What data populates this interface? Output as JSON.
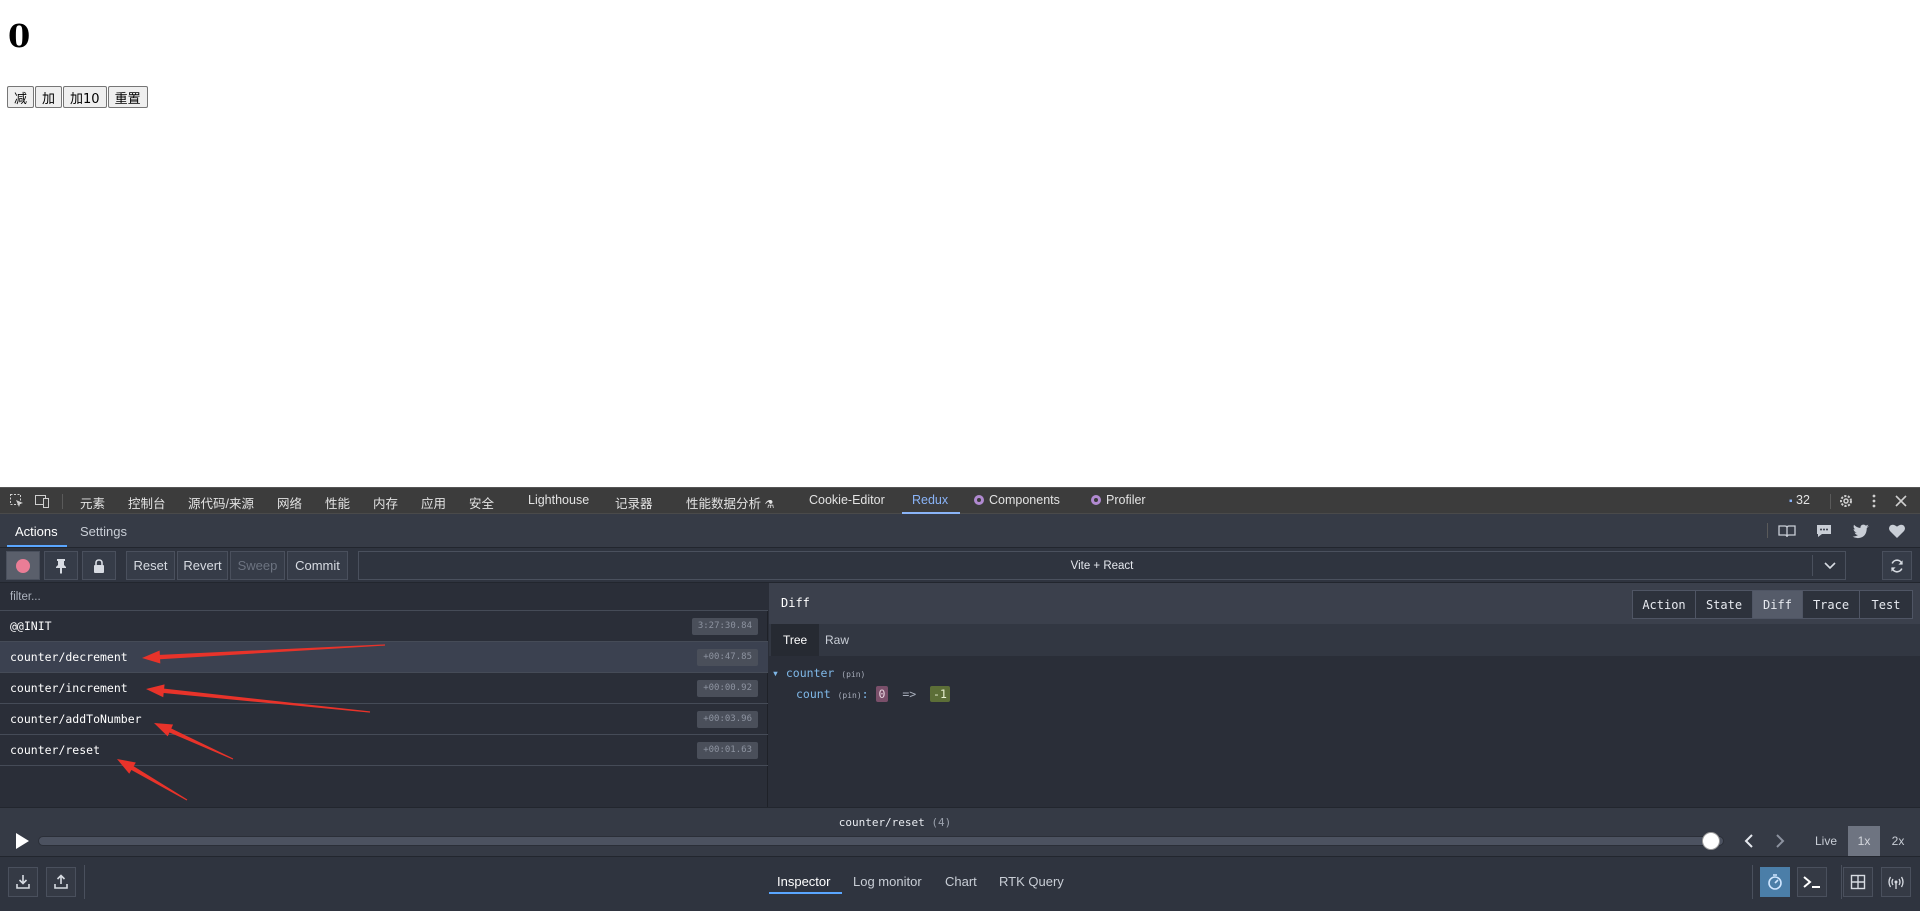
{
  "page": {
    "counter_value": "0",
    "buttons": [
      "减",
      "加",
      "加10",
      "重置"
    ]
  },
  "devtools": {
    "tabs": [
      "元素",
      "控制台",
      "源代码/来源",
      "网络",
      "性能",
      "内存",
      "应用",
      "安全",
      "Lighthouse",
      "记录器",
      "性能数据分析",
      "Cookie-Editor",
      "Redux",
      "Components",
      "Profiler"
    ],
    "active_tab": "Redux",
    "issues_count": "32"
  },
  "redux": {
    "top_tabs": [
      "Actions",
      "Settings"
    ],
    "toolbar": {
      "reset": "Reset",
      "revert": "Revert",
      "sweep": "Sweep",
      "commit": "Commit"
    },
    "instance": "Vite + React",
    "filter_placeholder": "filter...",
    "actions": [
      {
        "name": "@@INIT",
        "time": "3:27:30.84"
      },
      {
        "name": "counter/decrement",
        "time": "+00:47.85"
      },
      {
        "name": "counter/increment",
        "time": "+00:00.92"
      },
      {
        "name": "counter/addToNumber",
        "time": "+00:03.96"
      },
      {
        "name": "counter/reset",
        "time": "+00:01.63"
      }
    ],
    "panel_title": "Diff",
    "panel_tabs": [
      "Action",
      "State",
      "Diff",
      "Trace",
      "Test"
    ],
    "active_panel_tab": "Diff",
    "view_tabs": [
      "Tree",
      "Raw"
    ],
    "diff": {
      "root_key": "counter",
      "pin": "(pin)",
      "child_key": "count",
      "child_pin": "(pin)",
      "colon": ":",
      "old_value": "0",
      "arrow": "=>",
      "new_value": "-1"
    },
    "slider": {
      "label": "counter/reset",
      "count": "(4)",
      "value_fraction": 1.0
    },
    "speed": {
      "live": "Live",
      "one": "1x",
      "two": "2x",
      "active": "1x"
    },
    "monitors": [
      "Inspector",
      "Log monitor",
      "Chart",
      "RTK Query"
    ],
    "active_monitor": "Inspector"
  },
  "annotation_color": "#e8332a"
}
